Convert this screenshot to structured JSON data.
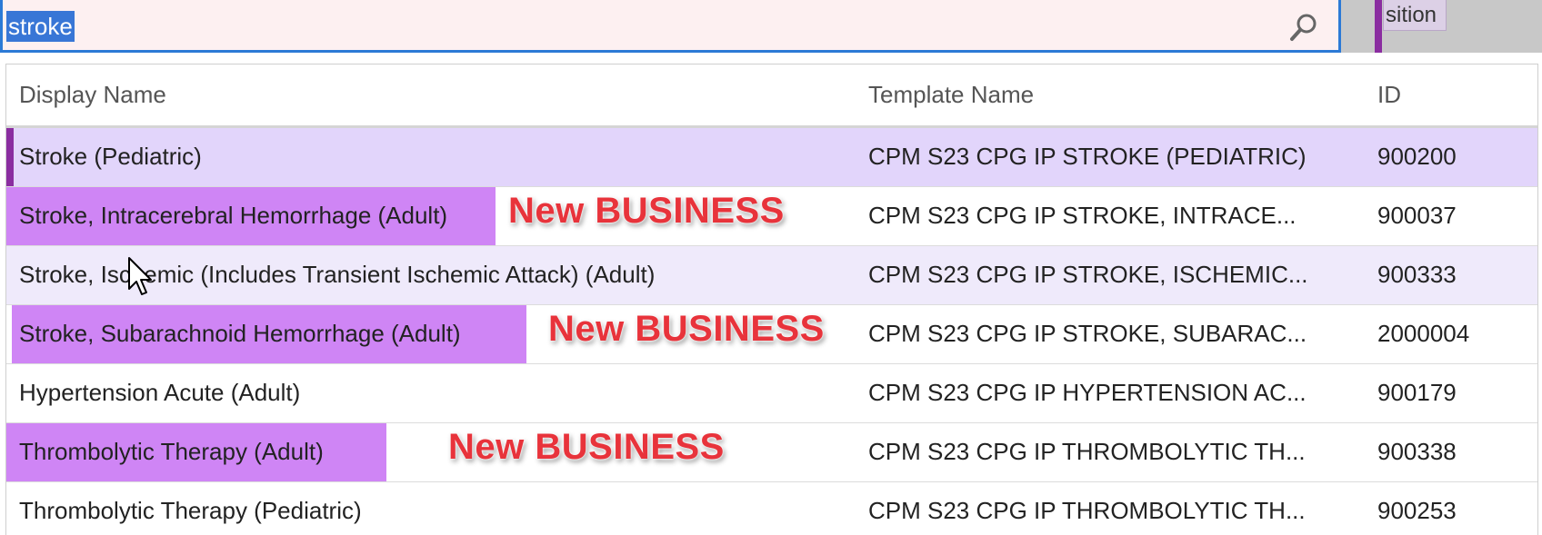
{
  "search": {
    "value": "stroke"
  },
  "partial_button": {
    "label": "sition"
  },
  "table": {
    "columns": {
      "display_name": "Display Name",
      "template_name": "Template Name",
      "id": "ID"
    },
    "rows": [
      {
        "display_name": "Stroke (Pediatric)",
        "template_name": "CPM S23 CPG IP STROKE (PEDIATRIC)",
        "id": "900200"
      },
      {
        "display_name": "Stroke, Intracerebral Hemorrhage (Adult)",
        "template_name": "CPM S23 CPG IP STROKE, INTRACE...",
        "id": "900037",
        "annotation": "New BUSINESS"
      },
      {
        "display_name": "Stroke, Ischemic (Includes Transient Ischemic Attack) (Adult)",
        "template_name": "CPM S23 CPG IP STROKE, ISCHEMIC...",
        "id": "900333"
      },
      {
        "display_name": "Stroke, Subarachnoid Hemorrhage (Adult)",
        "template_name": "CPM S23 CPG IP STROKE, SUBARAC...",
        "id": "2000004",
        "annotation": "New BUSINESS"
      },
      {
        "display_name": "Hypertension Acute (Adult)",
        "template_name": "CPM S23 CPG IP HYPERTENSION AC...",
        "id": "900179"
      },
      {
        "display_name": "Thrombolytic Therapy (Adult)",
        "template_name": "CPM S23 CPG IP THROMBOLYTIC TH...",
        "id": "900338",
        "annotation": "New BUSINESS"
      },
      {
        "display_name": "Thrombolytic Therapy (Pediatric)",
        "template_name": "CPM S23 CPG IP THROMBOLYTIC TH...",
        "id": "900253"
      }
    ]
  },
  "colors": {
    "selected_row": "#e2d5fb",
    "hover_row": "#efeafb",
    "highlight": "#cf85f5",
    "annotation": "#e8333b",
    "search_border": "#2c7ad6"
  }
}
